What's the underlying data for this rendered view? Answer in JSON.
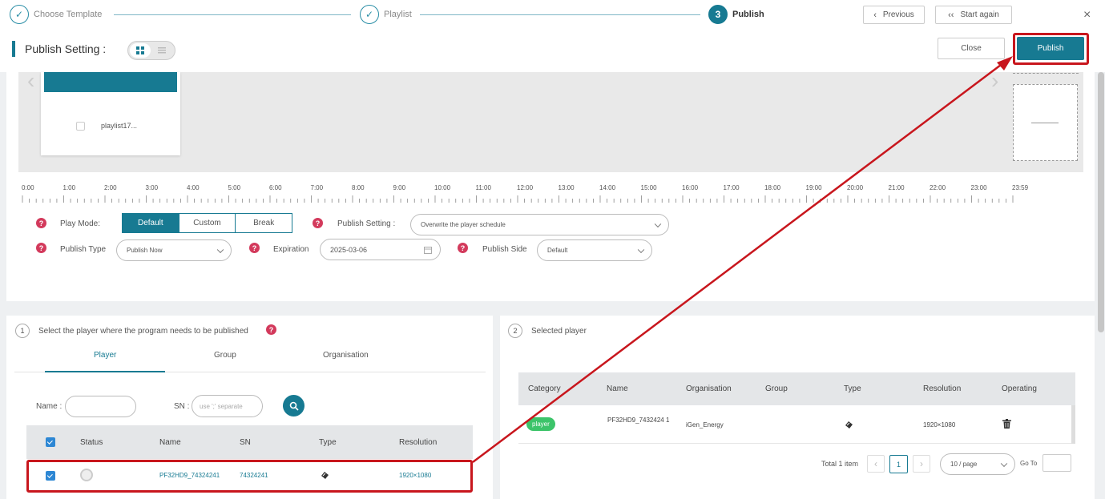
{
  "steps": [
    {
      "label": "Choose Template",
      "mark": "✓"
    },
    {
      "label": "Playlist",
      "mark": "✓"
    },
    {
      "label": "Publish",
      "mark": "3"
    }
  ],
  "header": {
    "previous": "Previous",
    "start_again": "Start again",
    "close_x": "×",
    "publish_setting_title": "Publish Setting :",
    "close": "Close",
    "publish": "Publish"
  },
  "playlist": {
    "name": "playlist17..."
  },
  "timeline": {
    "labels": [
      "0:00",
      "1:00",
      "2:00",
      "3:00",
      "4:00",
      "5:00",
      "6:00",
      "7:00",
      "8:00",
      "9:00",
      "10:00",
      "11:00",
      "12:00",
      "13:00",
      "14:00",
      "15:00",
      "16:00",
      "17:00",
      "18:00",
      "19:00",
      "20:00",
      "21:00",
      "22:00",
      "23:00",
      "23:59"
    ]
  },
  "settings": {
    "play_mode_label": "Play Mode:",
    "play_modes": [
      "Default",
      "Custom",
      "Break"
    ],
    "play_mode_selected": "Default",
    "publish_setting_label": "Publish Setting :",
    "publish_setting_value": "Overwrite the player schedule",
    "publish_type_label": "Publish Type",
    "publish_type_value": "Publish Now",
    "expiration_label": "Expiration",
    "expiration_value": "2025-03-06",
    "publish_side_label": "Publish Side",
    "publish_side_value": "Default"
  },
  "left_panel": {
    "num": "1",
    "title": "Select the player where the program needs to be published",
    "tabs": [
      "Player",
      "Group",
      "Organisation"
    ],
    "active_tab": "Player",
    "name_label": "Name :",
    "sn_label": "SN :",
    "sn_placeholder": "use ';' separate",
    "columns": [
      "Status",
      "Name",
      "SN",
      "Type",
      "Resolution"
    ],
    "rows": [
      {
        "name": "PF32HD9_74324241",
        "sn": "74324241",
        "resolution": "1920×1080",
        "checked": true
      }
    ]
  },
  "right_panel": {
    "num": "2",
    "title": "Selected player",
    "columns": [
      "Category",
      "Name",
      "Organisation",
      "Group",
      "Type",
      "Resolution",
      "Operating"
    ],
    "rows": [
      {
        "category": "player",
        "name": "PF32HD9_7432424 1",
        "organisation": "iGen_Energy",
        "group": "",
        "resolution": "1920×1080"
      }
    ],
    "pagination": {
      "total": "Total 1 item",
      "page": "1",
      "per_page": "10 / page",
      "goto": "Go To"
    }
  },
  "colors": {
    "accent": "#177a92",
    "highlight": "#c8161d",
    "help": "#d33a5c",
    "badge": "#3cc46a"
  }
}
